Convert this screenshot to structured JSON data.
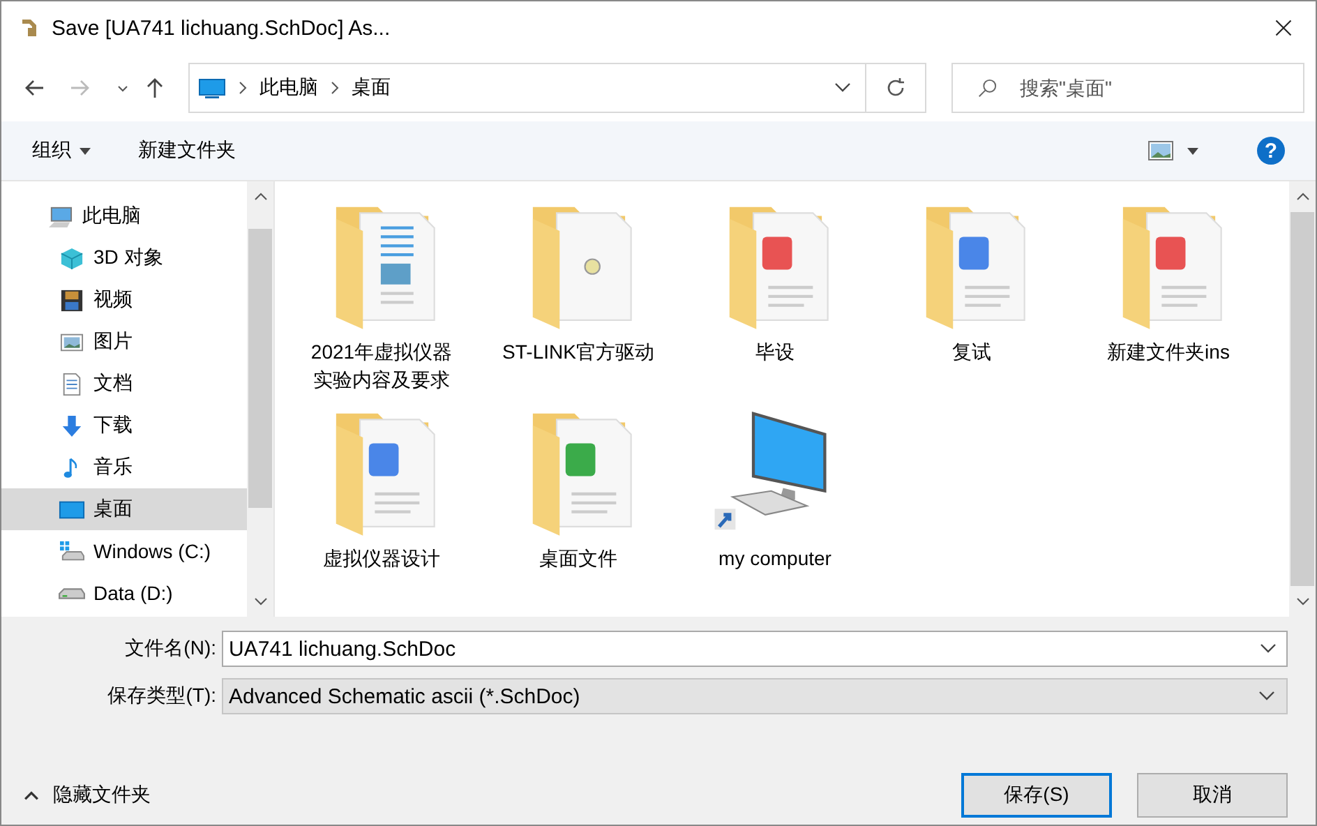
{
  "window": {
    "title": "Save [UA741 lichuang.SchDoc] As..."
  },
  "address_bar": {
    "path": [
      "此电脑",
      "桌面"
    ]
  },
  "search": {
    "placeholder": "搜索\"桌面\""
  },
  "toolbar": {
    "organize": "组织",
    "new_folder": "新建文件夹",
    "help": "?"
  },
  "sidebar": {
    "items": [
      {
        "label": "此电脑",
        "kind": "pc",
        "selected": false,
        "children": [
          {
            "label": "3D 对象",
            "kind": "cube",
            "selected": false
          },
          {
            "label": "视频",
            "kind": "film",
            "selected": false
          },
          {
            "label": "图片",
            "kind": "picture",
            "selected": false
          },
          {
            "label": "文档",
            "kind": "document",
            "selected": false
          },
          {
            "label": "下载",
            "kind": "download",
            "selected": false
          },
          {
            "label": "音乐",
            "kind": "music",
            "selected": false
          },
          {
            "label": "桌面",
            "kind": "desktop",
            "selected": true
          },
          {
            "label": "Windows (C:)",
            "kind": "systemdrive",
            "selected": false
          },
          {
            "label": "Data (D:)",
            "kind": "drive",
            "selected": false
          }
        ]
      }
    ]
  },
  "files": [
    {
      "name": "2021年虚拟仪器实验内容及要求",
      "kind": "image"
    },
    {
      "name": "ST-LINK官方驱动",
      "kind": "blank"
    },
    {
      "name": "毕设",
      "kind": "pdf"
    },
    {
      "name": "复试",
      "kind": "word"
    },
    {
      "name": "新建文件夹ins",
      "kind": "pdf"
    },
    {
      "name": "虚拟仪器设计",
      "kind": "word"
    },
    {
      "name": "桌面文件",
      "kind": "sheet"
    },
    {
      "name": "my computer",
      "kind": "shortcut"
    }
  ],
  "form": {
    "file_name": {
      "label": "文件名(N):",
      "value": "UA741 lichuang.SchDoc"
    },
    "file_type": {
      "label": "保存类型(T):",
      "value": "Advanced Schematic ascii (*.SchDoc)"
    }
  },
  "hide_folders": "隐藏文件夹",
  "buttons": [
    {
      "label": "保存(S)",
      "default": true
    },
    {
      "label": "取消",
      "default": false
    }
  ]
}
